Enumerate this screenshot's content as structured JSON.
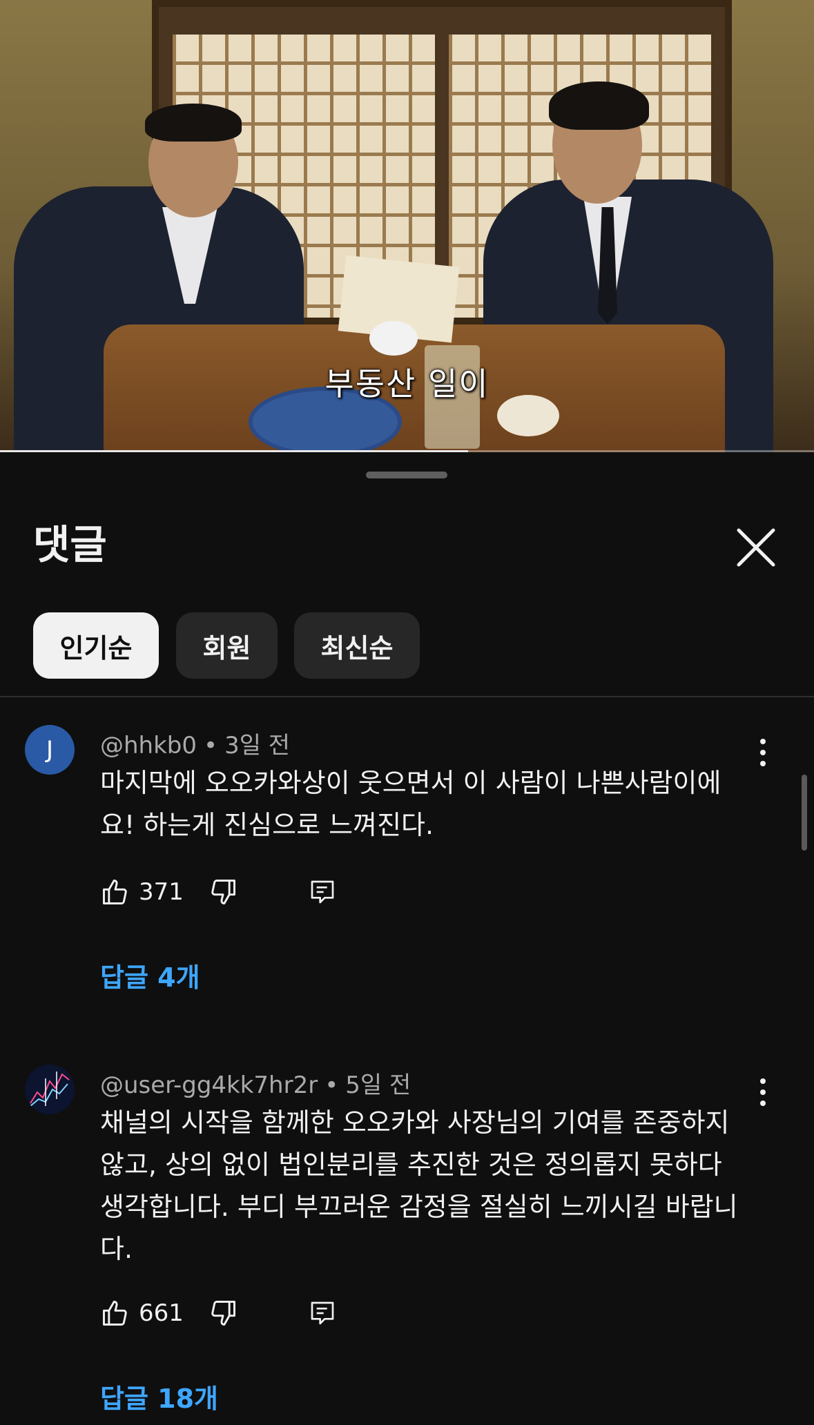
{
  "video": {
    "subtitle": "부동산 일이",
    "progress_fraction": 0.575
  },
  "comments_panel": {
    "title": "댓글",
    "filters": [
      {
        "label": "인기순",
        "active": true
      },
      {
        "label": "회원",
        "active": false
      },
      {
        "label": "최신순",
        "active": false
      }
    ],
    "comments": [
      {
        "avatar_letter": "J",
        "handle": "@hhkb0",
        "separator": "•",
        "time": "3일 전",
        "text": "마지막에 오오카와상이 웃으면서 이 사람이 나쁜사람이에요! 하는게 진심으로 느껴진다.",
        "likes": "371",
        "replies": "답글 4개"
      },
      {
        "avatar_letter": "",
        "handle": "@user-gg4kk7hr2r",
        "separator": "•",
        "time": "5일 전",
        "text": "채널의 시작을 함께한 오오카와 사장님의 기여를 존중하지 않고, 상의 없이 법인분리를 추진한 것은 정의롭지 못하다 생각합니다. 부디 부끄러운 감정을 절실히 느끼시길 바랍니다.",
        "likes": "661",
        "replies": "답글 18개"
      }
    ]
  },
  "colors": {
    "background": "#0f0f0f",
    "chip_active": "#f1f1f1",
    "chip_inactive": "#272727",
    "reply_link": "#3ea6ff",
    "meta_text": "#aaaaaa",
    "avatar_j": "#2a5aa6"
  },
  "icons": [
    "close-icon",
    "thumbs-up-icon",
    "thumbs-down-icon",
    "reply-icon",
    "more-vert-icon"
  ]
}
